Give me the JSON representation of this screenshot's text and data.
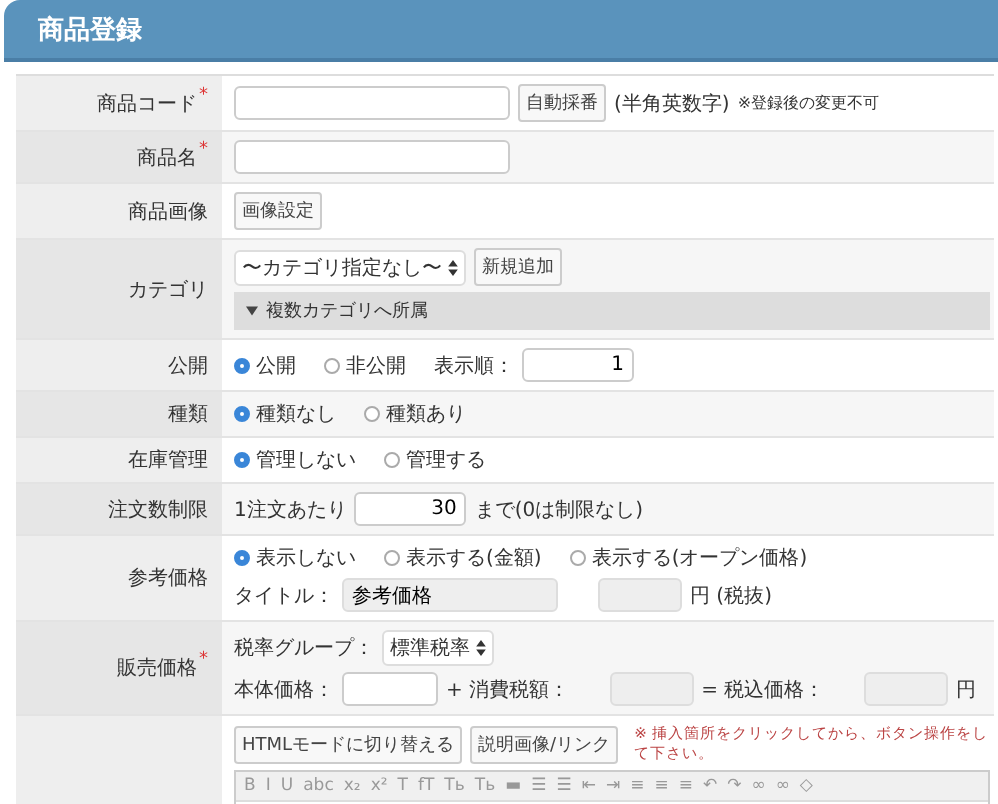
{
  "header": {
    "title": "商品登録"
  },
  "rows": [
    {
      "label": "商品コード",
      "required_mark": "*",
      "lines": [
        [
          {
            "kind": "text_field"
          },
          {
            "kind": "button",
            "label": "自動採番"
          },
          {
            "kind": "text",
            "text": "(半角英数字)"
          },
          {
            "kind": "small_note",
            "text": "※登録後の変更不可"
          }
        ]
      ]
    },
    {
      "label": "商品名",
      "required_mark": "*",
      "lines": [
        [
          {
            "kind": "text_field"
          }
        ]
      ]
    },
    {
      "label": "商品画像",
      "lines": [
        [
          {
            "kind": "button",
            "label": "画像設定"
          }
        ]
      ]
    },
    {
      "label": "カテゴリ",
      "lines": [
        [
          {
            "kind": "select",
            "value": "〜カテゴリ指定なし〜"
          },
          {
            "kind": "button",
            "label": "新規追加"
          }
        ],
        [
          {
            "kind": "expander",
            "label": "複数カテゴリへ所属"
          }
        ]
      ]
    },
    {
      "label": "公開",
      "lines": [
        [
          {
            "kind": "radio",
            "label": "公開",
            "selected": true
          },
          {
            "kind": "radio",
            "label": "非公開",
            "selected": false
          },
          {
            "kind": "text",
            "text": "表示順："
          },
          {
            "kind": "number_field",
            "value": "1"
          }
        ]
      ]
    },
    {
      "label": "種類",
      "lines": [
        [
          {
            "kind": "radio",
            "label": "種類なし",
            "selected": true
          },
          {
            "kind": "radio",
            "label": "種類あり",
            "selected": false
          }
        ]
      ]
    },
    {
      "label": "在庫管理",
      "lines": [
        [
          {
            "kind": "radio",
            "label": "管理しない",
            "selected": true
          },
          {
            "kind": "radio",
            "label": "管理する",
            "selected": false
          }
        ]
      ]
    },
    {
      "label": "注文数制限",
      "lines": [
        [
          {
            "kind": "text",
            "text": "1注文あたり"
          },
          {
            "kind": "number_field",
            "value": "30"
          },
          {
            "kind": "text",
            "text": "まで(0は制限なし)"
          }
        ]
      ]
    },
    {
      "label": "参考価格",
      "lines": [
        [
          {
            "kind": "radio",
            "label": "表示しない",
            "selected": true
          },
          {
            "kind": "radio",
            "label": "表示する(金額)",
            "selected": false
          },
          {
            "kind": "radio",
            "label": "表示する(オープン価格)",
            "selected": false
          }
        ],
        [
          {
            "kind": "text",
            "text": "タイトル："
          },
          {
            "kind": "readonly_field",
            "value": "参考価格"
          },
          {
            "kind": "readonly_field"
          },
          {
            "kind": "text",
            "text": "円 (税抜)"
          }
        ]
      ]
    },
    {
      "label": "販売価格",
      "required_mark": "*",
      "lines": [
        [
          {
            "kind": "text",
            "text": "税率グループ："
          },
          {
            "kind": "select",
            "value": "標準税率"
          }
        ],
        [
          {
            "kind": "text",
            "text": "本体価格："
          },
          {
            "kind": "price_field"
          },
          {
            "kind": "text",
            "text": "+ 消費税額："
          },
          {
            "kind": "readonly_field"
          },
          {
            "kind": "text",
            "text": "= 税込価格："
          },
          {
            "kind": "readonly_field"
          },
          {
            "kind": "text",
            "text": "円"
          }
        ]
      ]
    },
    {
      "lines": [
        [
          {
            "kind": "button",
            "label": "HTMLモードに切り替える"
          },
          {
            "kind": "button",
            "label": "説明画像/リンク"
          },
          {
            "kind": "note",
            "text": "※ 挿入箇所をクリックしてから、ボタン操作をして下さい。"
          }
        ],
        [
          {
            "kind": "editor",
            "toolbar": [
              "B",
              "I",
              "U",
              "abc",
              "x₂",
              "x²",
              "T",
              "fT",
              "Tь",
              "Tь",
              "▬",
              "☰",
              "☰",
              "⇤",
              "⇥",
              "≡",
              "≡",
              "≡",
              "↶",
              "↷",
              "∞",
              "∞",
              "◇"
            ]
          }
        ]
      ]
    }
  ]
}
